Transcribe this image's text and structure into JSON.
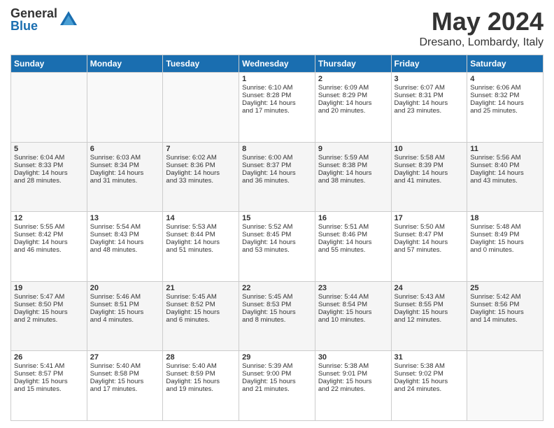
{
  "header": {
    "logo_general": "General",
    "logo_blue": "Blue",
    "title": "May 2024",
    "location": "Dresano, Lombardy, Italy"
  },
  "days_of_week": [
    "Sunday",
    "Monday",
    "Tuesday",
    "Wednesday",
    "Thursday",
    "Friday",
    "Saturday"
  ],
  "weeks": [
    [
      {
        "day": "",
        "info": ""
      },
      {
        "day": "",
        "info": ""
      },
      {
        "day": "",
        "info": ""
      },
      {
        "day": "1",
        "info": "Sunrise: 6:10 AM\nSunset: 8:28 PM\nDaylight: 14 hours\nand 17 minutes."
      },
      {
        "day": "2",
        "info": "Sunrise: 6:09 AM\nSunset: 8:29 PM\nDaylight: 14 hours\nand 20 minutes."
      },
      {
        "day": "3",
        "info": "Sunrise: 6:07 AM\nSunset: 8:31 PM\nDaylight: 14 hours\nand 23 minutes."
      },
      {
        "day": "4",
        "info": "Sunrise: 6:06 AM\nSunset: 8:32 PM\nDaylight: 14 hours\nand 25 minutes."
      }
    ],
    [
      {
        "day": "5",
        "info": "Sunrise: 6:04 AM\nSunset: 8:33 PM\nDaylight: 14 hours\nand 28 minutes."
      },
      {
        "day": "6",
        "info": "Sunrise: 6:03 AM\nSunset: 8:34 PM\nDaylight: 14 hours\nand 31 minutes."
      },
      {
        "day": "7",
        "info": "Sunrise: 6:02 AM\nSunset: 8:36 PM\nDaylight: 14 hours\nand 33 minutes."
      },
      {
        "day": "8",
        "info": "Sunrise: 6:00 AM\nSunset: 8:37 PM\nDaylight: 14 hours\nand 36 minutes."
      },
      {
        "day": "9",
        "info": "Sunrise: 5:59 AM\nSunset: 8:38 PM\nDaylight: 14 hours\nand 38 minutes."
      },
      {
        "day": "10",
        "info": "Sunrise: 5:58 AM\nSunset: 8:39 PM\nDaylight: 14 hours\nand 41 minutes."
      },
      {
        "day": "11",
        "info": "Sunrise: 5:56 AM\nSunset: 8:40 PM\nDaylight: 14 hours\nand 43 minutes."
      }
    ],
    [
      {
        "day": "12",
        "info": "Sunrise: 5:55 AM\nSunset: 8:42 PM\nDaylight: 14 hours\nand 46 minutes."
      },
      {
        "day": "13",
        "info": "Sunrise: 5:54 AM\nSunset: 8:43 PM\nDaylight: 14 hours\nand 48 minutes."
      },
      {
        "day": "14",
        "info": "Sunrise: 5:53 AM\nSunset: 8:44 PM\nDaylight: 14 hours\nand 51 minutes."
      },
      {
        "day": "15",
        "info": "Sunrise: 5:52 AM\nSunset: 8:45 PM\nDaylight: 14 hours\nand 53 minutes."
      },
      {
        "day": "16",
        "info": "Sunrise: 5:51 AM\nSunset: 8:46 PM\nDaylight: 14 hours\nand 55 minutes."
      },
      {
        "day": "17",
        "info": "Sunrise: 5:50 AM\nSunset: 8:47 PM\nDaylight: 14 hours\nand 57 minutes."
      },
      {
        "day": "18",
        "info": "Sunrise: 5:48 AM\nSunset: 8:49 PM\nDaylight: 15 hours\nand 0 minutes."
      }
    ],
    [
      {
        "day": "19",
        "info": "Sunrise: 5:47 AM\nSunset: 8:50 PM\nDaylight: 15 hours\nand 2 minutes."
      },
      {
        "day": "20",
        "info": "Sunrise: 5:46 AM\nSunset: 8:51 PM\nDaylight: 15 hours\nand 4 minutes."
      },
      {
        "day": "21",
        "info": "Sunrise: 5:45 AM\nSunset: 8:52 PM\nDaylight: 15 hours\nand 6 minutes."
      },
      {
        "day": "22",
        "info": "Sunrise: 5:45 AM\nSunset: 8:53 PM\nDaylight: 15 hours\nand 8 minutes."
      },
      {
        "day": "23",
        "info": "Sunrise: 5:44 AM\nSunset: 8:54 PM\nDaylight: 15 hours\nand 10 minutes."
      },
      {
        "day": "24",
        "info": "Sunrise: 5:43 AM\nSunset: 8:55 PM\nDaylight: 15 hours\nand 12 minutes."
      },
      {
        "day": "25",
        "info": "Sunrise: 5:42 AM\nSunset: 8:56 PM\nDaylight: 15 hours\nand 14 minutes."
      }
    ],
    [
      {
        "day": "26",
        "info": "Sunrise: 5:41 AM\nSunset: 8:57 PM\nDaylight: 15 hours\nand 15 minutes."
      },
      {
        "day": "27",
        "info": "Sunrise: 5:40 AM\nSunset: 8:58 PM\nDaylight: 15 hours\nand 17 minutes."
      },
      {
        "day": "28",
        "info": "Sunrise: 5:40 AM\nSunset: 8:59 PM\nDaylight: 15 hours\nand 19 minutes."
      },
      {
        "day": "29",
        "info": "Sunrise: 5:39 AM\nSunset: 9:00 PM\nDaylight: 15 hours\nand 21 minutes."
      },
      {
        "day": "30",
        "info": "Sunrise: 5:38 AM\nSunset: 9:01 PM\nDaylight: 15 hours\nand 22 minutes."
      },
      {
        "day": "31",
        "info": "Sunrise: 5:38 AM\nSunset: 9:02 PM\nDaylight: 15 hours\nand 24 minutes."
      },
      {
        "day": "",
        "info": ""
      }
    ]
  ]
}
